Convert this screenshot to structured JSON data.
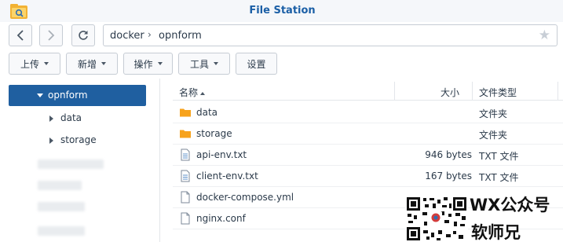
{
  "window": {
    "title": "File Station"
  },
  "path": {
    "segments": [
      "docker",
      "opnform"
    ]
  },
  "toolbar": {
    "upload": "上传",
    "create": "新增",
    "action": "操作",
    "tools": "工具",
    "settings": "设置"
  },
  "tree": {
    "selected": "opnform",
    "children": [
      "data",
      "storage"
    ]
  },
  "table": {
    "columns": {
      "name": "名称",
      "size": "大小",
      "type": "文件类型"
    },
    "rows": [
      {
        "name": "data",
        "size": "",
        "type": "文件夹",
        "kind": "folder"
      },
      {
        "name": "storage",
        "size": "",
        "type": "文件夹",
        "kind": "folder"
      },
      {
        "name": "api-env.txt",
        "size": "946 bytes",
        "type": "TXT 文件",
        "kind": "txt"
      },
      {
        "name": "client-env.txt",
        "size": "167 bytes",
        "type": "TXT 文件",
        "kind": "txt"
      },
      {
        "name": "docker-compose.yml",
        "size": "",
        "type": "",
        "kind": "file"
      },
      {
        "name": "nginx.conf",
        "size": "",
        "type": "",
        "kind": "file"
      }
    ]
  },
  "watermark": {
    "line1": "WX公众号",
    "line2": "软师兄"
  },
  "colors": {
    "accent": "#1f5fa0",
    "title": "#1b5fa6",
    "folder": "#f7a21b"
  },
  "icons": [
    "file-station-icon",
    "back-icon",
    "forward-icon",
    "refresh-icon",
    "breadcrumb-separator-icon",
    "favorite-star-icon",
    "folder-icon",
    "text-file-icon",
    "file-icon",
    "qr-code-icon"
  ]
}
